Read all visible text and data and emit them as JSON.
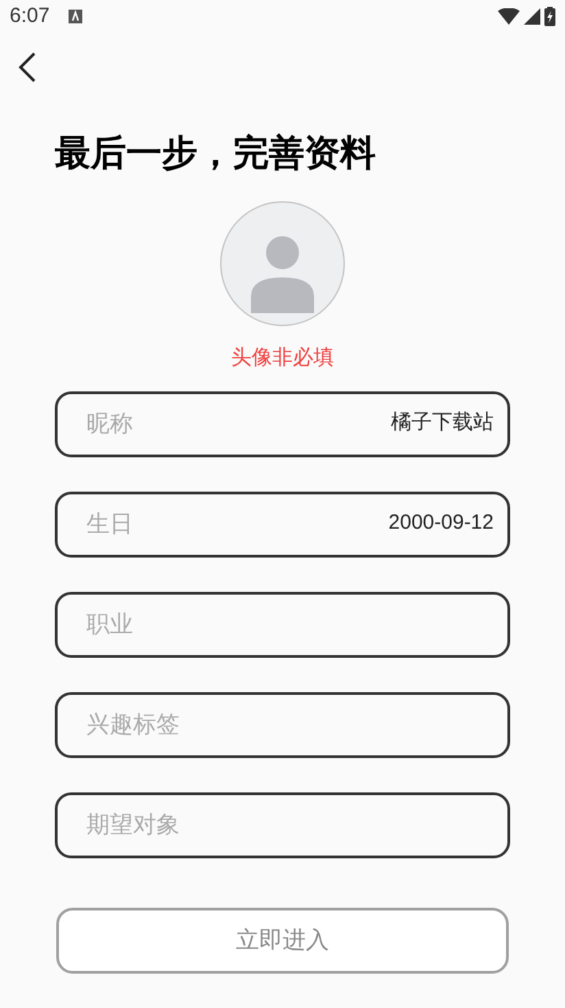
{
  "status_bar": {
    "time": "6:07"
  },
  "title": "最后一步，完善资料",
  "avatar_hint": "头像非必填",
  "fields": [
    {
      "label": "昵称",
      "value": "橘子下载站"
    },
    {
      "label": "生日",
      "value": "2000-09-12"
    },
    {
      "label": "职业"
    },
    {
      "label": "兴趣标签"
    },
    {
      "label": "期望对象"
    }
  ],
  "submit": {
    "label": "立即进入",
    "disabled": true
  }
}
